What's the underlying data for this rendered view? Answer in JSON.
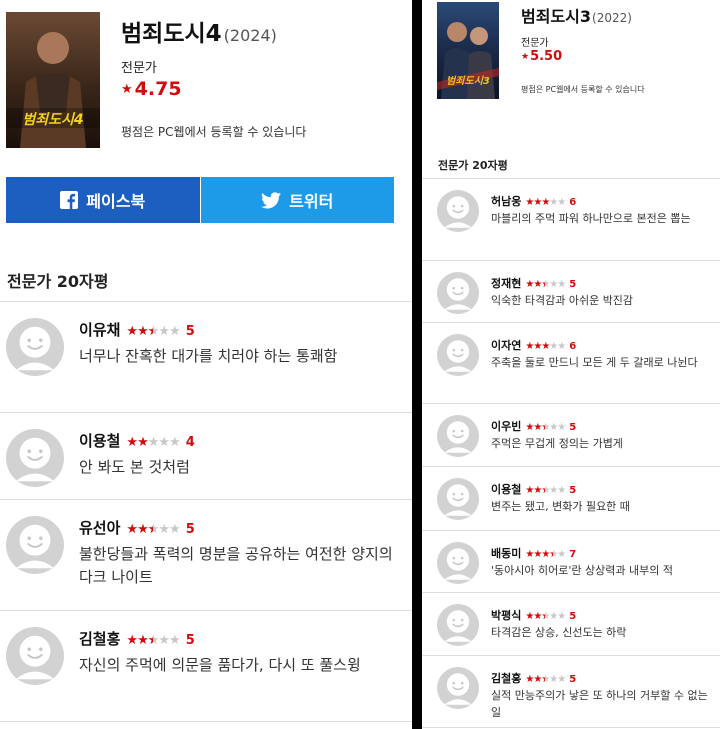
{
  "left": {
    "movie": {
      "title": "범죄도시4",
      "year": "(2024)",
      "expert_label": "전문가",
      "score": "4.75",
      "notice": "평점은 PC웹에서 등록할 수 있습니다",
      "poster_caption": "범죄도시4"
    },
    "share": {
      "facebook_label": "페이스북",
      "twitter_label": "트위터"
    },
    "section_title": "전문가 20자평",
    "reviews": [
      {
        "name": "이유채",
        "rating": 5,
        "comment": "너무나 잔혹한 대가를 치러야 하는 통쾌함"
      },
      {
        "name": "이용철",
        "rating": 4,
        "comment": "안 봐도 본 것처럼"
      },
      {
        "name": "유선아",
        "rating": 5,
        "comment": "불한당들과 폭력의 명분을 공유하는 여전한 양지의 다크 나이트"
      },
      {
        "name": "김철홍",
        "rating": 5,
        "comment": "자신의 주먹에 의문을 품다가, 다시 또 풀스윙"
      }
    ]
  },
  "right": {
    "movie": {
      "title": "범죄도시3",
      "year": "(2022)",
      "expert_label": "전문가",
      "score": "5.50",
      "notice": "평점은 PC웹에서 등록할 수 있습니다",
      "poster_caption": "범죄도시3"
    },
    "section_title": "전문가 20자평",
    "reviews": [
      {
        "name": "허남웅",
        "rating": 6,
        "comment": "마블리의 주먹 파워 하나만으로 본전은 뽑는"
      },
      {
        "name": "정재현",
        "rating": 5,
        "comment": "익숙한 타격감과 아쉬운 박진감"
      },
      {
        "name": "이자연",
        "rating": 6,
        "comment": "주축을 둘로 만드니 모든 게 두 갈래로 나뉜다"
      },
      {
        "name": "이우빈",
        "rating": 5,
        "comment": "주먹은 무겁게 정의는 가볍게"
      },
      {
        "name": "이용철",
        "rating": 5,
        "comment": "변주는 됐고, 변화가 필요한 때"
      },
      {
        "name": "배동미",
        "rating": 7,
        "comment": "'동아시아 히어로'란 상상력과 내부의 적"
      },
      {
        "name": "박평식",
        "rating": 5,
        "comment": "타격감은 상승, 신선도는 하락"
      },
      {
        "name": "김철홍",
        "rating": 5,
        "comment": "실적 만능주의가 낳은 또 하나의 거부할 수 없는 일"
      }
    ]
  },
  "icons": {
    "score_star": "star-icon",
    "facebook": "facebook-icon",
    "twitter": "twitter-icon",
    "avatar": "avatar-icon"
  },
  "colors": {
    "accent_red": "#d10c0c",
    "facebook_blue": "#1d5fc0",
    "twitter_blue": "#1d9be9",
    "star_off": "#c8c8c8"
  }
}
